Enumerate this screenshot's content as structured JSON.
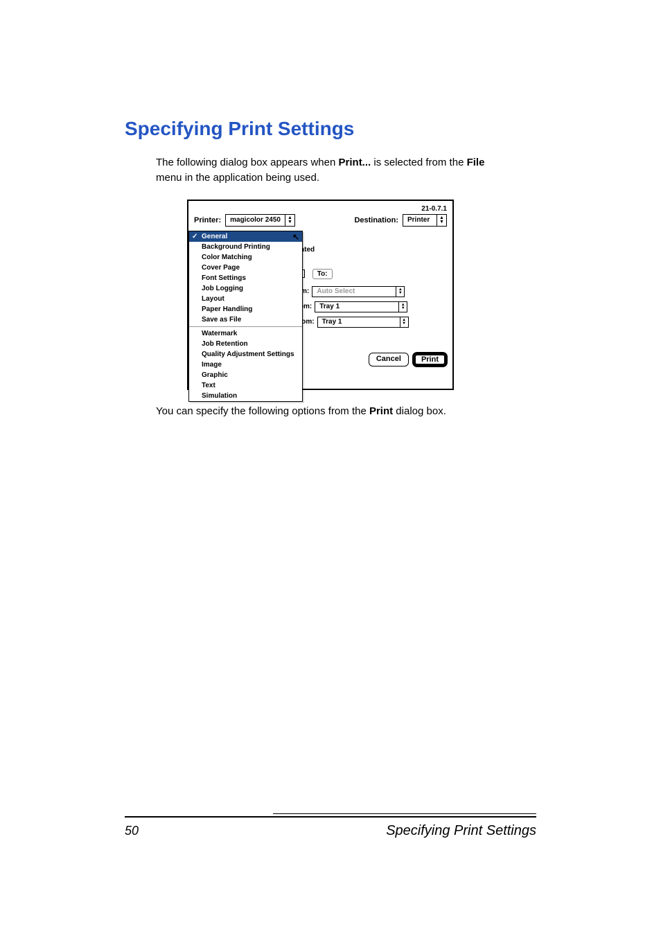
{
  "heading": "Specifying Print Settings",
  "intro": {
    "prefix": "The following dialog box appears when ",
    "bold1": "Print...",
    "mid": " is selected from the ",
    "bold2": "File",
    "suffix": " menu in the application being used."
  },
  "outro": {
    "prefix": "You can specify the following options from the ",
    "bold1": "Print",
    "suffix": " dialog box."
  },
  "dialog": {
    "version": "21-0.7.1",
    "printer_label": "Printer:",
    "printer_value": "magicolor 2450",
    "destination_label": "Destination:",
    "destination_value": "Printer",
    "menu": [
      {
        "label": "General",
        "selected": true
      },
      {
        "label": "Background Printing"
      },
      {
        "label": "Color Matching"
      },
      {
        "label": "Cover Page"
      },
      {
        "label": "Font Settings"
      },
      {
        "label": "Job Logging"
      },
      {
        "label": "Layout"
      },
      {
        "label": "Paper Handling"
      },
      {
        "label": "Save as File"
      },
      {
        "sep": true
      },
      {
        "label": "Watermark"
      },
      {
        "label": "Job Retention"
      },
      {
        "label": "Quality Adjustment Settings"
      },
      {
        "label": "Image"
      },
      {
        "label": "Graphic"
      },
      {
        "label": "Text"
      },
      {
        "label": "Simulation"
      }
    ],
    "right": {
      "llated": "llated",
      "to_label": "To:",
      "om_label": "om:",
      "om_value": "Auto Select",
      "rom_label": "rom:",
      "rom_value": "Tray 1",
      "from_label": "from:",
      "from_value": "Tray 1"
    },
    "cancel": "Cancel",
    "print": "Print"
  },
  "footer": {
    "page_number": "50",
    "title": "Specifying Print Settings"
  }
}
